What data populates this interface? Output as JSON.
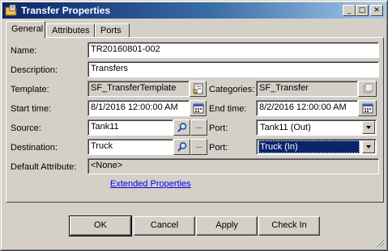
{
  "window": {
    "title": "Transfer Properties",
    "icon": "folder-properties-icon",
    "controls": {
      "minimize": "_",
      "maximize": "□",
      "close": "✕"
    }
  },
  "tabs": [
    {
      "label": "General",
      "active": true
    },
    {
      "label": "Attributes",
      "active": false
    },
    {
      "label": "Ports",
      "active": false
    }
  ],
  "form": {
    "name": {
      "label": "Name:",
      "value": "TR20160801-002"
    },
    "description": {
      "label": "Description:",
      "value": "Transfers"
    },
    "template": {
      "label": "Template:",
      "value": "SF_TransferTemplate"
    },
    "categories": {
      "label": "Categories:",
      "value": "SF_Transfer"
    },
    "start_time": {
      "label": "Start time:",
      "value": "8/1/2016 12:00:00 AM"
    },
    "end_time": {
      "label": "End time:",
      "value": "8/2/2016 12:00:00 AM"
    },
    "source": {
      "label": "Source:",
      "value": "Tank11"
    },
    "source_port": {
      "label": "Port:",
      "value": "Tank11 (Out)"
    },
    "destination": {
      "label": "Destination:",
      "value": "Truck"
    },
    "destination_port": {
      "label": "Port:",
      "value": "Truck (In)"
    },
    "default_attribute": {
      "label": "Default Attribute:",
      "value": "<None>"
    },
    "extended_link": "Extended Properties",
    "ellipsis": "..."
  },
  "buttons": {
    "ok": "OK",
    "cancel": "Cancel",
    "apply": "Apply",
    "check_in": "Check In"
  },
  "colors": {
    "title_start": "#0a246a",
    "title_end": "#a6caf0",
    "face": "#d4d0c8",
    "selection": "#0a246a",
    "link": "#0000ee"
  }
}
